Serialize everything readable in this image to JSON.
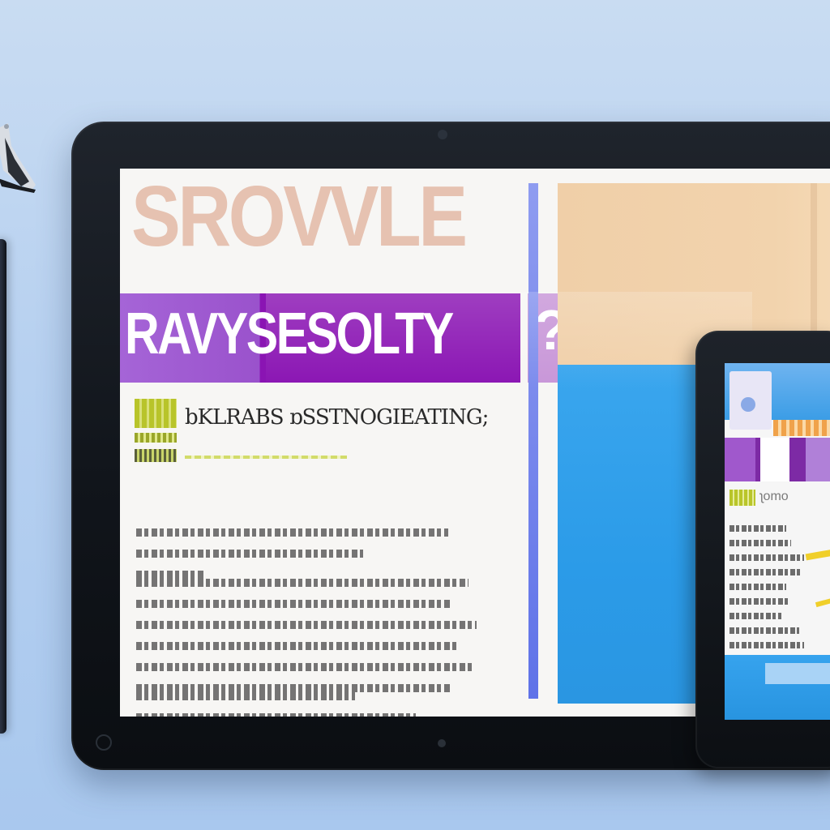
{
  "screen": {
    "headline": "SROVVLE",
    "banner_text": "RAVYSESOLTY",
    "banner_badge_glyph": "?",
    "subhead": "bKLRABS ɒSSTNOGIEATING;"
  },
  "phone": {
    "lime_text": "ʅomo"
  },
  "colors": {
    "background": "#b6d0f0",
    "tablet_frame": "#11151b",
    "headline_peach": "#e6c2b1",
    "banner_purple": "#8a14b3",
    "banner_lavender": "#a666d8",
    "panel_peach": "#f2d3ad",
    "panel_blue": "#2b9be8",
    "accent_rule": "#5f72e8",
    "lime": "#b8c42a"
  },
  "icons": {
    "left_gadget": "drone-icon"
  }
}
